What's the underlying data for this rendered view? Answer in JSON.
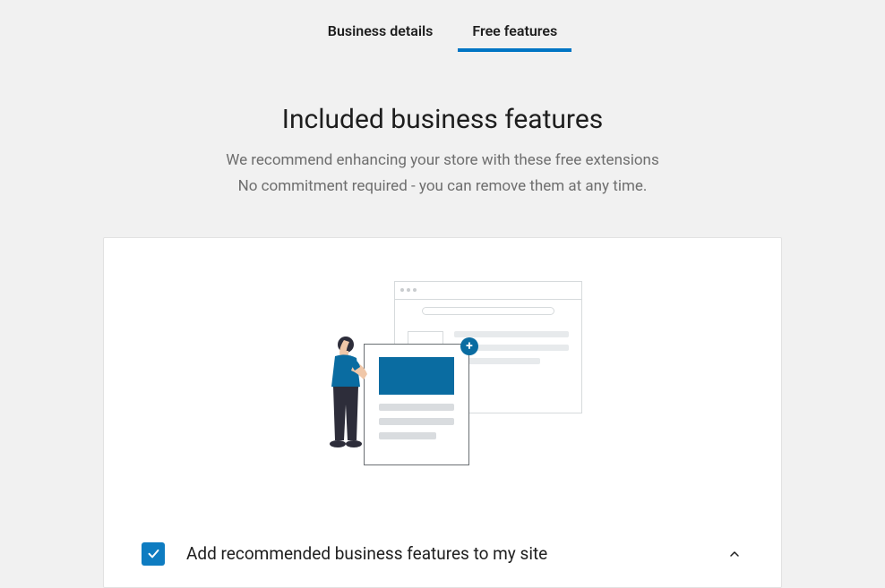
{
  "tabs": {
    "business_details": "Business details",
    "free_features": "Free features"
  },
  "header": {
    "title": "Included business features",
    "subtitle_line1": "We recommend enhancing your store with these free extensions",
    "subtitle_line2": "No commitment required - you can remove them at any time."
  },
  "checkbox": {
    "label": "Add recommended business features to my site",
    "checked": true
  },
  "icons": {
    "plus": "+"
  },
  "colors": {
    "accent": "#0e7cc1",
    "illustration_blue": "#0a6ca1"
  }
}
